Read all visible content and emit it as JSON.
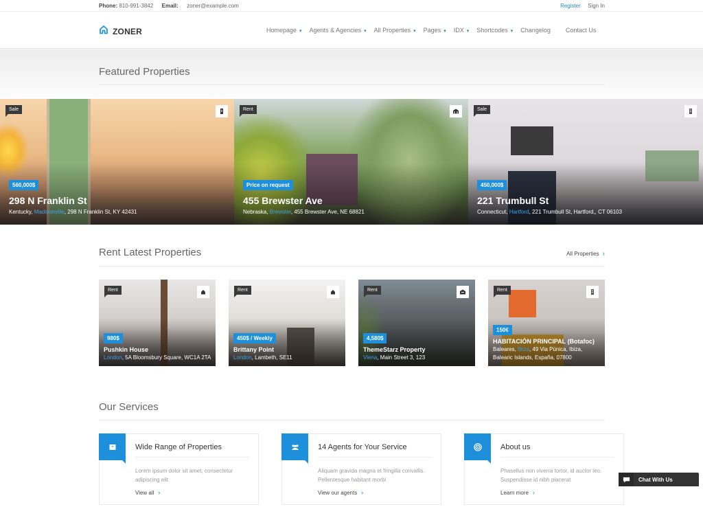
{
  "topbar": {
    "phone_label": "Phone:",
    "phone": "810-991-3842",
    "email_label": "Email:",
    "email": "zoner@example.com",
    "register": "Register",
    "signin": "Sign In"
  },
  "header": {
    "logo_icon": "house-icon",
    "brand": "ZONER",
    "nav": [
      {
        "label": "Homepage",
        "dropdown": true
      },
      {
        "label": "Agents & Agencies",
        "dropdown": true
      },
      {
        "label": "All Properties",
        "dropdown": true
      },
      {
        "label": "Pages",
        "dropdown": true
      },
      {
        "label": "IDX",
        "dropdown": true
      },
      {
        "label": "Shortcodes",
        "dropdown": true
      },
      {
        "label": "Changelog",
        "dropdown": false
      },
      {
        "label": "Contact Us",
        "dropdown": false
      }
    ],
    "caret": "▾"
  },
  "featured": {
    "title": "Featured Properties",
    "items": [
      {
        "tag": "Sale",
        "type_icon": "apartment-icon",
        "price": "560,000$",
        "title": "298 N Franklin St",
        "state": "Kentucky, ",
        "city": "Madisonville",
        "rest": ", 298 N Franklin St, KY 42431"
      },
      {
        "tag": "Rent",
        "type_icon": "villa-icon",
        "price": "Price on request",
        "title": "455 Brewster Ave",
        "state": "Nebraska, ",
        "city": "Brewster",
        "rest": ", 455 Brewster Ave, NE 68821"
      },
      {
        "tag": "Sale",
        "type_icon": "condo-icon",
        "price": "450,000$",
        "title": "221 Trumbull St",
        "state": "Connecticut, ",
        "city": "Hartford",
        "rest": ", 221 Trumbull St, Hartford,, CT 06103"
      }
    ]
  },
  "rent": {
    "title": "Rent Latest Properties",
    "all_link": "All Properties",
    "chevron": "›",
    "items": [
      {
        "tag": "Rent",
        "type_icon": "house-icon",
        "price": "980$",
        "title": "Pushkin House",
        "city": "London",
        "rest": ", 5A Bloomsbury Square, WC1A 2TA"
      },
      {
        "tag": "Rent",
        "type_icon": "house-icon",
        "price": "450$ / Weekly",
        "title": "Brittany Point",
        "city": "London",
        "rest": ", Lambeth, SE11"
      },
      {
        "tag": "Rent",
        "type_icon": "building-icon",
        "price": "4,580$",
        "title": "ThemeStarz Property",
        "city": "Viena",
        "rest": ", Main Street 3, 123"
      },
      {
        "tag": "Rent",
        "type_icon": "condo-icon",
        "price": "150€",
        "title": "HABITACIÓN PRINCIPAL (Botafoc)",
        "state": "Baleares, ",
        "city": "Ibiza",
        "rest": ", 49 Via Púnica, Ibiza, Balearic Islands, España, 07800"
      }
    ]
  },
  "services": {
    "title": "Our Services",
    "chevron": "›",
    "items": [
      {
        "icon": "archive-box-icon",
        "title": "Wide Range of Properties",
        "desc": "Lorem ipsum dolor sit amet, consectetur adipiscing elit",
        "link": "View all"
      },
      {
        "icon": "users-icon",
        "title": "14 Agents for Your Service",
        "desc": "Aliquam gravida magna et fringilla convallis. Pellentesque habitant morbi",
        "link": "View our agents"
      },
      {
        "icon": "target-icon",
        "title": "About us",
        "desc": "Phasellus non viverra tortor, id auctor leo. Suspendisse id nibh placerat",
        "link": "Learn more"
      }
    ]
  },
  "chat": {
    "label": "Chat With Us",
    "icon": "speech-bubble-icon"
  },
  "colors": {
    "accent": "#1e8fdb",
    "tag_bg": "#3a3a3a",
    "link": "#3ea2e6"
  }
}
